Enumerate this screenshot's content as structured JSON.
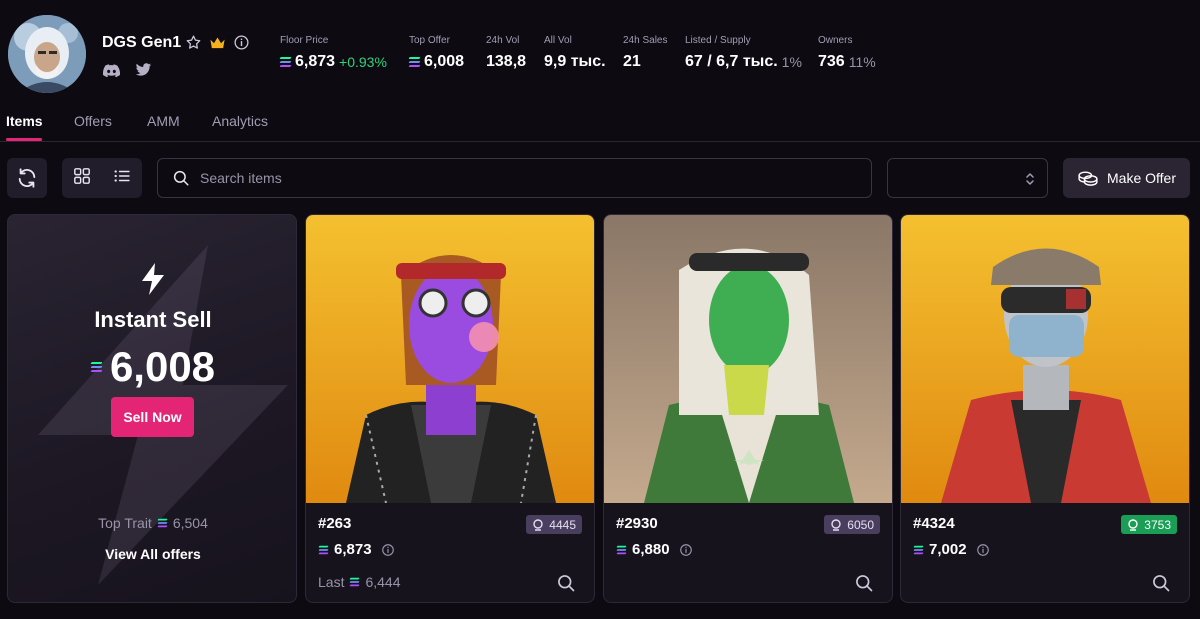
{
  "collection": {
    "name": "DGS Gen1"
  },
  "stats": [
    {
      "label": "Floor Price",
      "value": "6,873",
      "change": "+0.93%",
      "sol": true
    },
    {
      "label": "Top Offer",
      "value": "6,008",
      "sol": true
    },
    {
      "label": "24h Vol",
      "value": "138,8"
    },
    {
      "label": "All Vol",
      "value": "9,9 тыс."
    },
    {
      "label": "24h Sales",
      "value": "21"
    },
    {
      "label": "Listed / Supply",
      "value": "67 / 6,7 тыс.",
      "pct": "1%"
    },
    {
      "label": "Owners",
      "value": "736",
      "pct": "11%"
    }
  ],
  "tabs": [
    "Items",
    "Offers",
    "AMM",
    "Analytics"
  ],
  "toolbar": {
    "search_placeholder": "Search items",
    "make_offer": "Make Offer"
  },
  "instant_sell": {
    "title": "Instant Sell",
    "price": "6,008",
    "sell_label": "Sell Now",
    "top_trait_label": "Top Trait",
    "top_trait_value": "6,504",
    "view_all": "View All offers"
  },
  "items": [
    {
      "name": "#263",
      "rank": "4445",
      "price": "6,873",
      "last_label": "Last",
      "last_value": "6,444",
      "rank_color": "#4a3e5e"
    },
    {
      "name": "#2930",
      "rank": "6050",
      "price": "6,880",
      "rank_color": "#4a3e5e"
    },
    {
      "name": "#4324",
      "rank": "3753",
      "price": "7,002",
      "rank_color": "#1a9e55"
    }
  ],
  "colors": {
    "accent": "#e42575",
    "positive": "#2bd47b",
    "background": "#0d0a12"
  },
  "icons": [
    "star-icon",
    "crown-icon",
    "info-icon",
    "discord-icon",
    "twitter-icon",
    "refresh-icon",
    "grid-view-icon",
    "list-view-icon",
    "search-icon",
    "chevron-updown-icon",
    "coins-icon",
    "bolt-icon",
    "rarity-icon",
    "zoom-icon"
  ]
}
